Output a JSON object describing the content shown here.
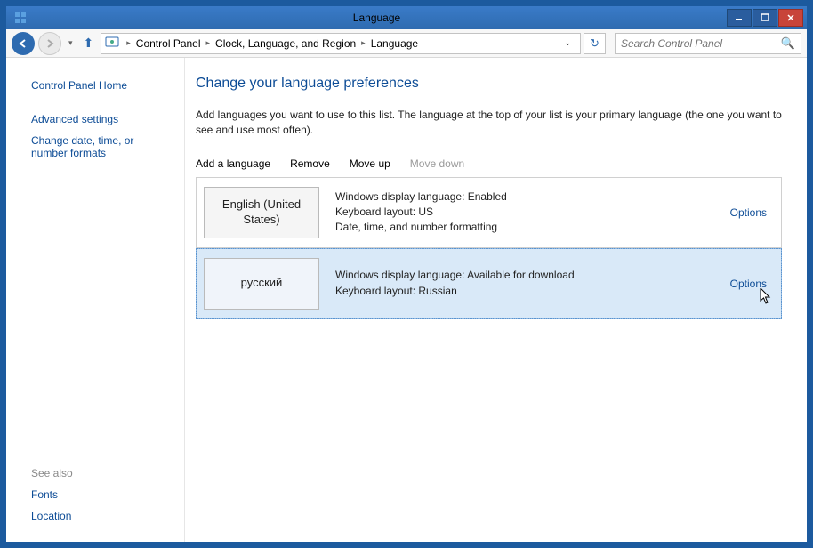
{
  "window": {
    "title": "Language"
  },
  "breadcrumb": {
    "items": [
      "Control Panel",
      "Clock, Language, and Region",
      "Language"
    ]
  },
  "search": {
    "placeholder": "Search Control Panel"
  },
  "sidebar": {
    "home": "Control Panel Home",
    "links": [
      "Advanced settings",
      "Change date, time, or number formats"
    ],
    "see_also_label": "See also",
    "see_also": [
      "Fonts",
      "Location"
    ]
  },
  "main": {
    "title": "Change your language preferences",
    "desc": "Add languages you want to use to this list. The language at the top of your list is your primary language (the one you want to see and use most often).",
    "actions": {
      "add": "Add a language",
      "remove": "Remove",
      "move_up": "Move up",
      "move_down": "Move down"
    },
    "options_label": "Options",
    "languages": [
      {
        "name": "English (United States)",
        "details": [
          "Windows display language: Enabled",
          "Keyboard layout: US",
          "Date, time, and number formatting"
        ],
        "selected": false
      },
      {
        "name": "русский",
        "details": [
          "Windows display language: Available for download",
          "Keyboard layout: Russian"
        ],
        "selected": true
      }
    ]
  }
}
